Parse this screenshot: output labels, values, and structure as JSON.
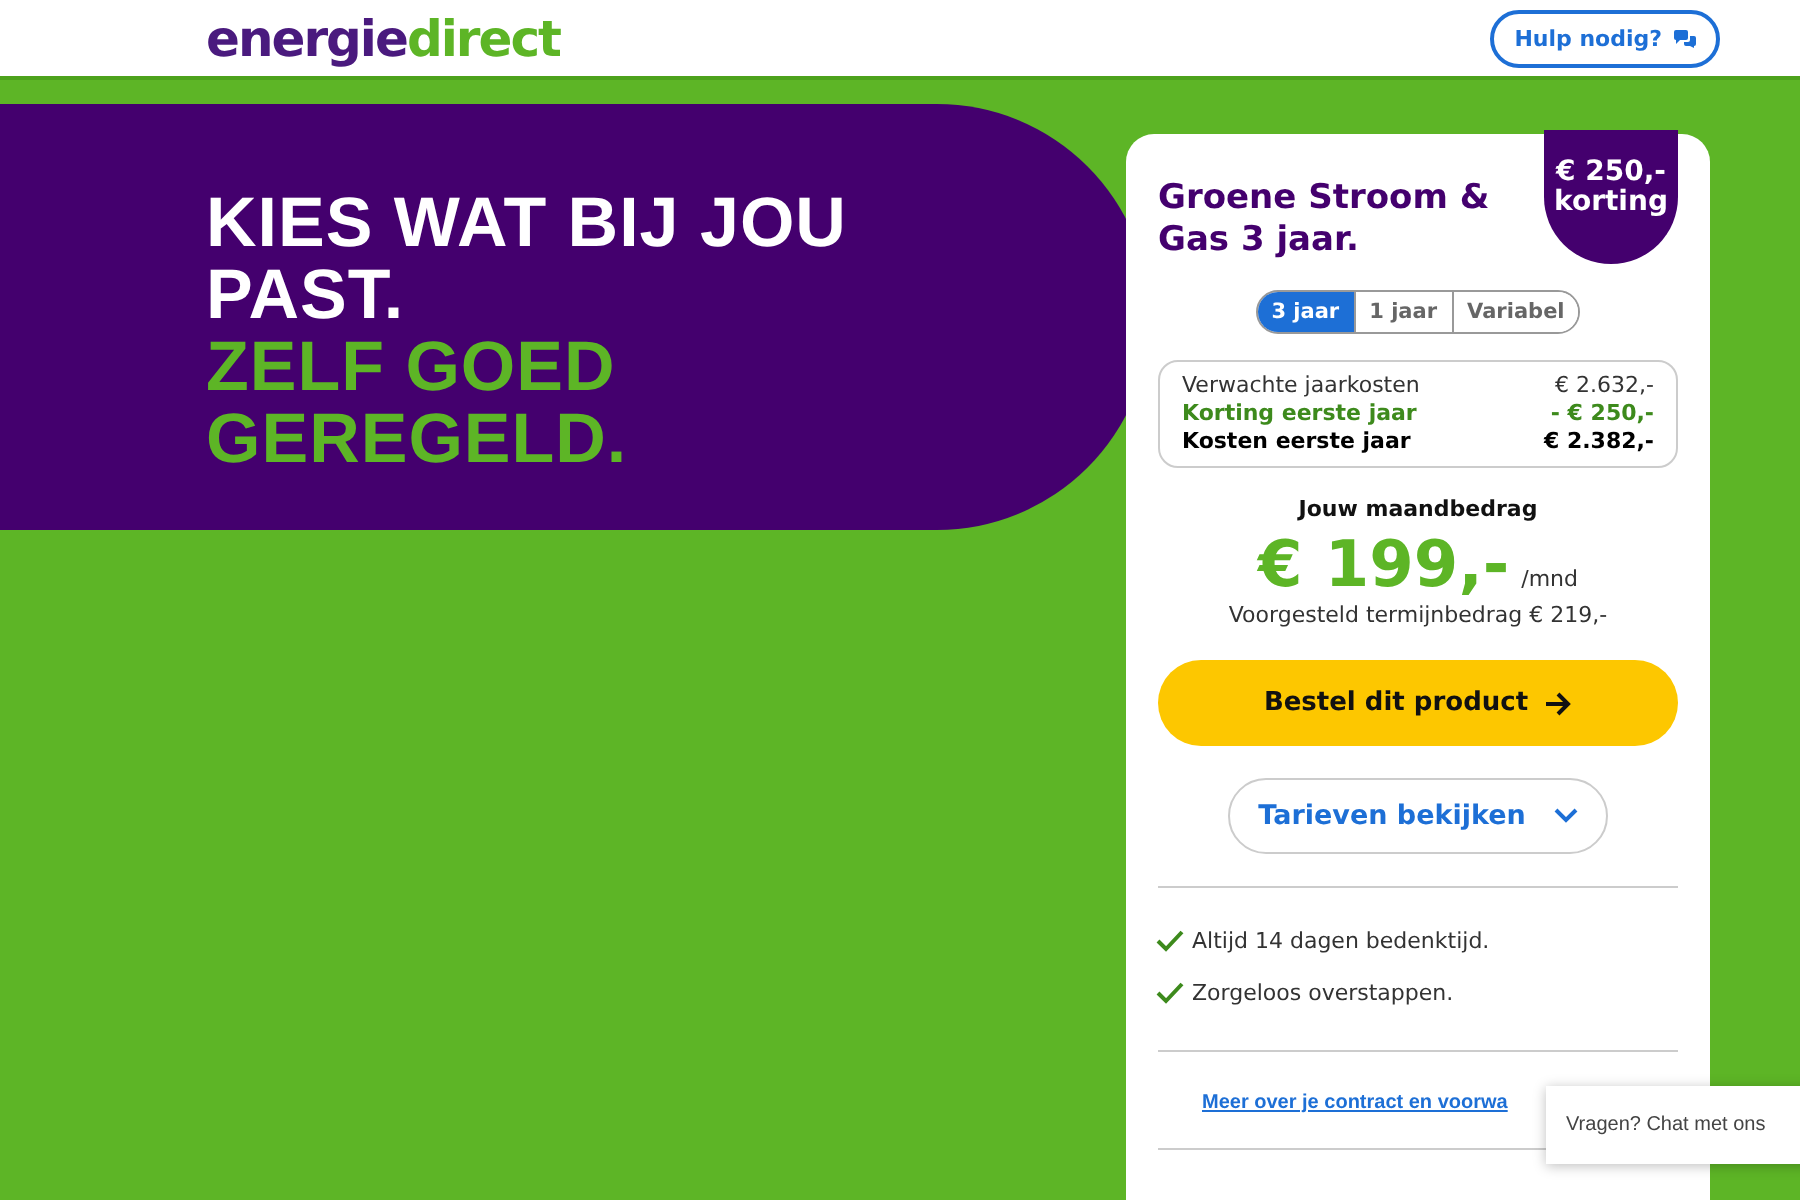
{
  "header": {
    "logo": {
      "part_1": "energie",
      "part_2": "direct"
    },
    "help_button": "Hulp nodig?"
  },
  "hero": {
    "lines": [
      {
        "text": "KIES WAT BIJ JOU",
        "kind": "white"
      },
      {
        "text": "PAST.",
        "kind": "white"
      },
      {
        "text": "ZELF GOED",
        "kind": "green"
      },
      {
        "text": "GEREGELD.",
        "kind": "green"
      }
    ]
  },
  "card": {
    "title": "Groene Stroom & Gas 3 jaar.",
    "badge": {
      "amount": "€ 250,-",
      "label": "korting"
    },
    "tabs": [
      {
        "label": "3 jaar",
        "selected": true
      },
      {
        "label": "1 jaar",
        "selected": false
      },
      {
        "label": "Variabel",
        "selected": false
      }
    ],
    "costs": [
      {
        "label": "Verwachte jaarkosten",
        "value": "€ 2.632,-",
        "kind": "normal"
      },
      {
        "label": "Korting eerste jaar",
        "value": "- € 250,-",
        "kind": "discount"
      },
      {
        "label": "Kosten eerste jaar",
        "value": "€ 2.382,-",
        "kind": "total"
      }
    ],
    "monthly_label": "Jouw maandbedrag",
    "monthly_amount": "€ 199,-",
    "monthly_unit": "/mnd",
    "suggested": "Voorgesteld termijnbedrag € 219,-",
    "order_button": "Bestel dit product",
    "rates_button": "Tarieven bekijken",
    "benefits": [
      "Altijd 14 dagen bedenktijd.",
      "Zorgeloos overstappen."
    ],
    "contract_link": "Meer over je contract en voorwa"
  },
  "chat": {
    "label": "Vragen? Chat met ons"
  }
}
